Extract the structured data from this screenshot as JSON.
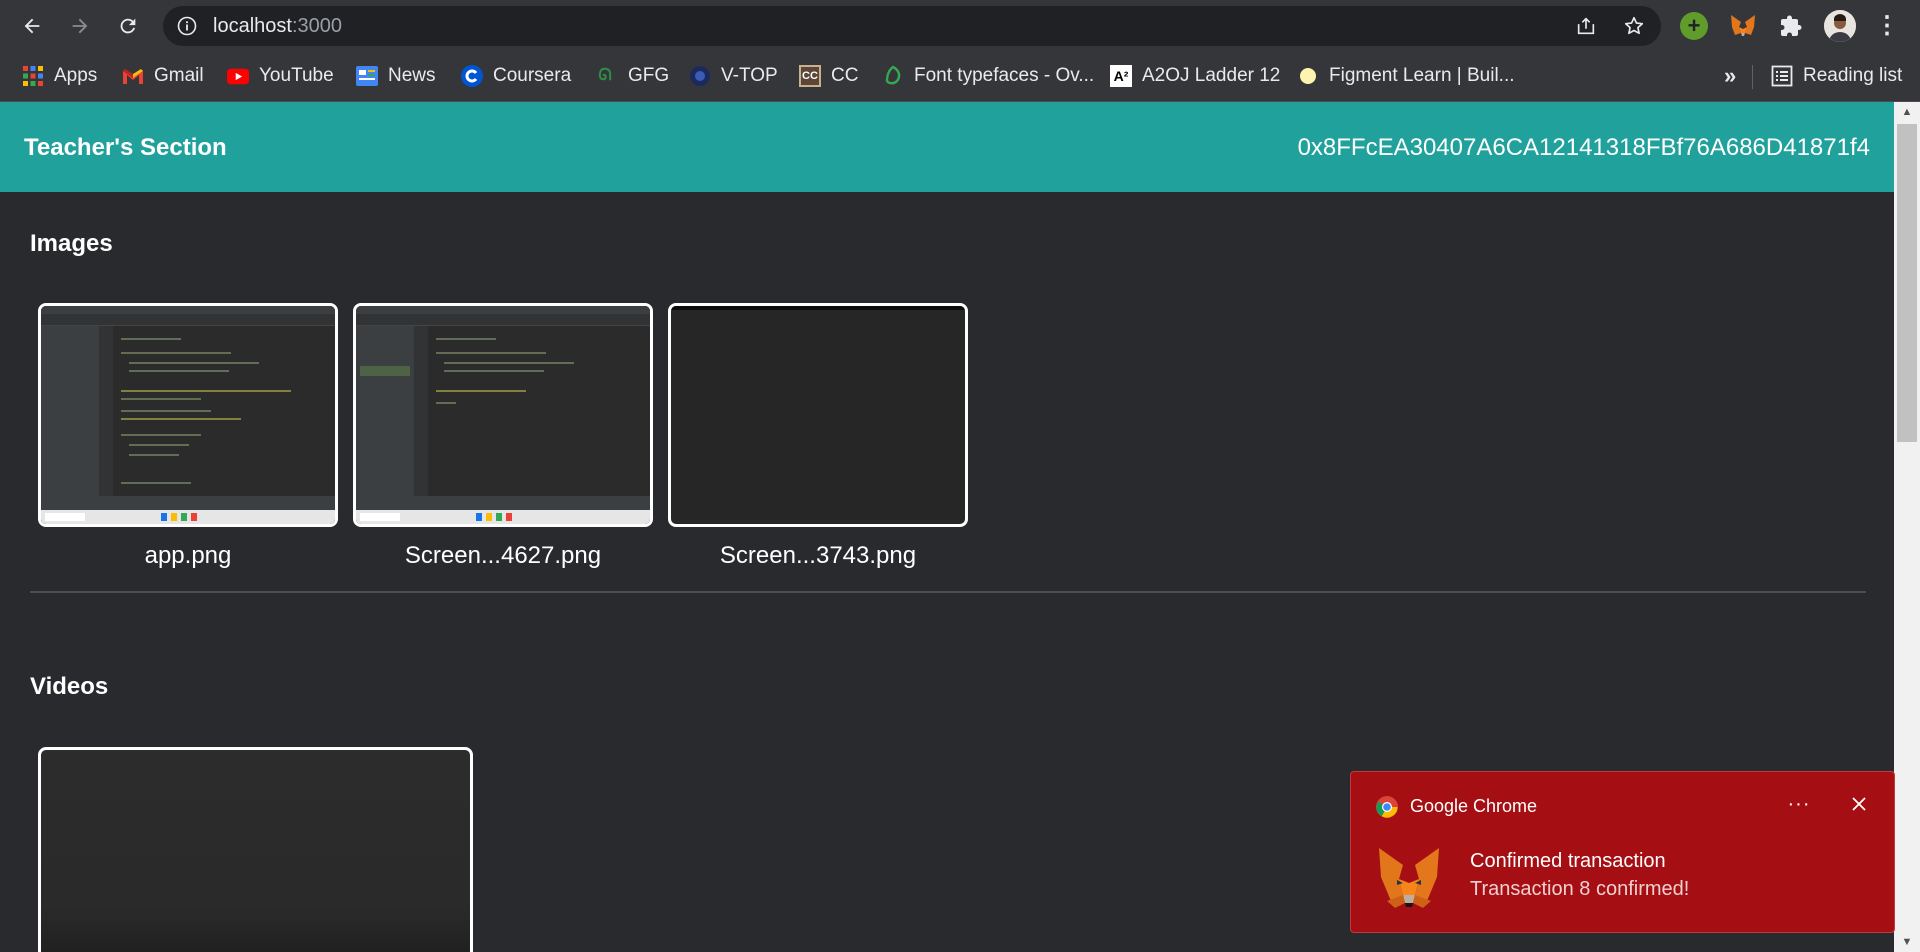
{
  "browser": {
    "url_host": "localhost",
    "url_port": ":3000",
    "icons": [
      "back-icon",
      "forward-icon",
      "reload-icon",
      "info-icon",
      "share-icon",
      "star-icon",
      "extension-plus-icon",
      "metamask-fox-icon",
      "puzzle-icon",
      "profile-avatar",
      "kebab-menu-icon"
    ]
  },
  "bookmarks": {
    "items": [
      {
        "label": "Apps",
        "icon": "apps-grid-icon"
      },
      {
        "label": "Gmail",
        "icon": "gmail-icon"
      },
      {
        "label": "YouTube",
        "icon": "youtube-icon"
      },
      {
        "label": "News",
        "icon": "news-icon"
      },
      {
        "label": "Coursera",
        "icon": "coursera-icon"
      },
      {
        "label": "GFG",
        "icon": "gfg-icon"
      },
      {
        "label": "V-TOP",
        "icon": "vtop-icon"
      },
      {
        "label": "CC",
        "icon": "codechef-icon"
      },
      {
        "label": "Font typefaces - Ov...",
        "icon": "leaf-icon"
      },
      {
        "label": "A2OJ Ladder 12",
        "icon": "a2oj-icon"
      },
      {
        "label": "Figment Learn | Buil...",
        "icon": "figment-icon"
      }
    ],
    "overflow": "»",
    "reading_list": "Reading list"
  },
  "app": {
    "title": "Teacher's Section",
    "account": "0x8FFcEA30407A6CA12141318FBf76A686D41871f4",
    "header_color": "#21a19c"
  },
  "images_section": {
    "title": "Images",
    "items": [
      {
        "caption": "app.png"
      },
      {
        "caption": "Screen...4627.png"
      },
      {
        "caption": "Screen...3743.png"
      }
    ]
  },
  "videos_section": {
    "title": "Videos"
  },
  "notification": {
    "app_name": "Google Chrome",
    "more": "···",
    "heading": "Confirmed transaction",
    "body": "Transaction 8 confirmed!",
    "background": "#a50e13"
  }
}
